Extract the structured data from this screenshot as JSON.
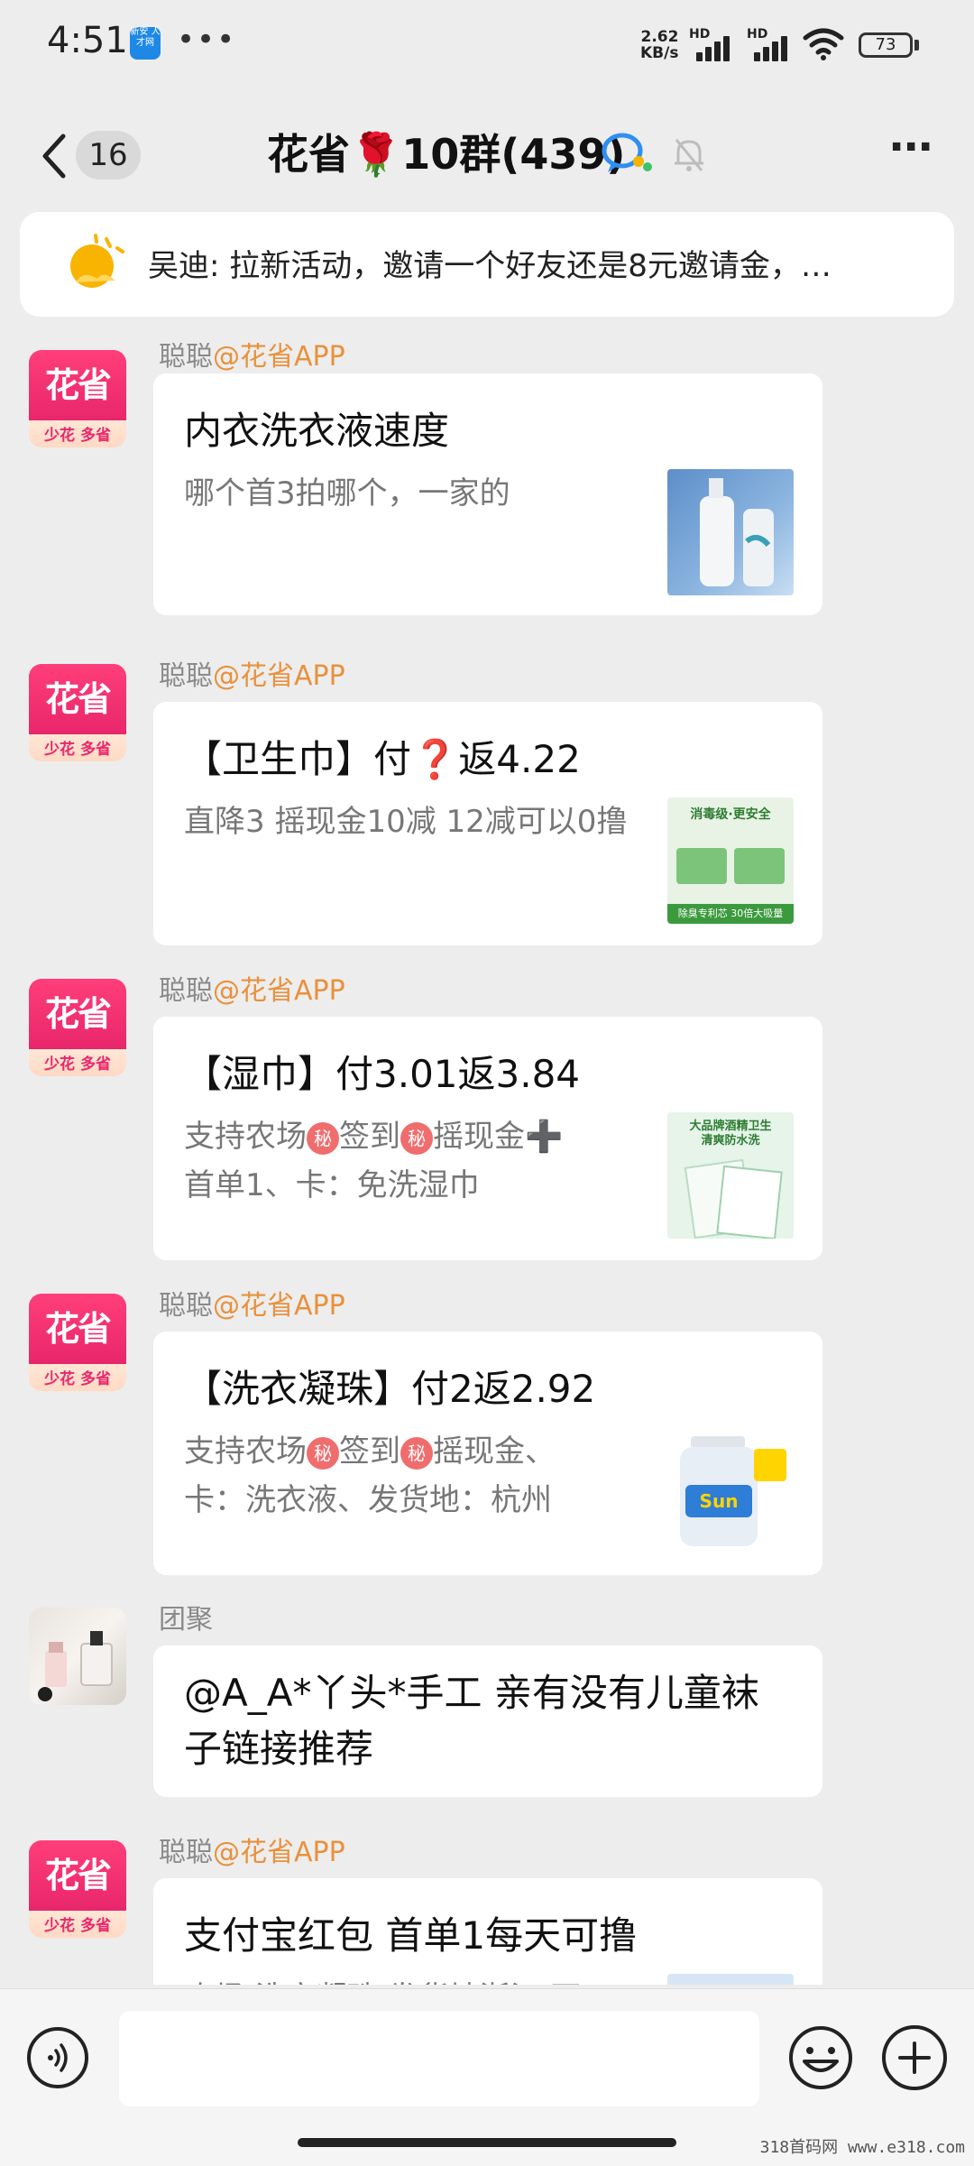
{
  "status_bar": {
    "time": "4:51",
    "app_badge": "新安\n人才网",
    "dots": "•••",
    "net_speed_value": "2.62",
    "net_speed_unit": "KB/s",
    "hd1": "HD",
    "hd2": "HD",
    "battery": "73"
  },
  "header": {
    "unread_count": "16",
    "title": "花省🌹10群(439)",
    "more": "⋯"
  },
  "notice": {
    "text": "吴迪: 拉新活动，邀请一个好友还是8元邀请金，…"
  },
  "messages": [
    {
      "sender_name": "聪聪",
      "sender_at": "@花省APP",
      "avatar_logo": "花省",
      "avatar_tag": "少花 多省",
      "title": "内衣洗衣液速度",
      "desc": "哪个首3拍哪个，一家的",
      "image": "laundry-detergent-bottle-image"
    },
    {
      "sender_name": "聪聪",
      "sender_at": "@花省APP",
      "avatar_logo": "花省",
      "avatar_tag": "少花 多省",
      "title": "【卫生巾】付❓返4.22",
      "desc": "直降3 摇现金10减  12减可以0撸",
      "image": "sanitary-pad-pack-image",
      "image_text_top": "消毒级·更安全",
      "image_text_bottom": "除臭专利芯 30倍大吸量"
    },
    {
      "sender_name": "聪聪",
      "sender_at": "@花省APP",
      "avatar_logo": "花省",
      "avatar_tag": "少花 多省",
      "title": "【湿巾】付3.01返3.84",
      "desc_a": "支持农场",
      "desc_b": "签到",
      "desc_c": "摇现金➕",
      "desc_d": "首单1、卡：免洗湿巾",
      "secret_glyph": "秘",
      "image": "wet-wipes-pack-image",
      "image_text_top": "大品牌酒精卫生\n清爽防水洗"
    },
    {
      "sender_name": "聪聪",
      "sender_at": "@花省APP",
      "avatar_logo": "花省",
      "avatar_tag": "少花 多省",
      "title": "【洗衣凝珠】付2返2.92",
      "desc_a": "支持农场",
      "desc_b": "签到",
      "desc_c": "摇现金、",
      "desc_d": "卡：洗衣液、发货地：杭州",
      "secret_glyph": "秘",
      "image": "laundry-jug-image",
      "image_text": "Sun"
    },
    {
      "sender_name": "团聚",
      "text": "@A_A*丫头*手工  亲有没有儿童袜子链接推荐"
    },
    {
      "sender_name": "聪聪",
      "sender_at": "@花省APP",
      "avatar_logo": "花省",
      "avatar_tag": "少花 多省",
      "title": "支付宝红包 首单1每天可撸",
      "desc": "农场 洗衣凝珠 发货地浙江 不"
    }
  ],
  "input_bar": {
    "placeholder": ""
  },
  "watermark": "318首码网  www.e318.com",
  "colors": {
    "background": "#ededed",
    "brand_pink": "#e8266b",
    "at_orange": "#e8913c",
    "secret_red": "#f06d6d"
  }
}
